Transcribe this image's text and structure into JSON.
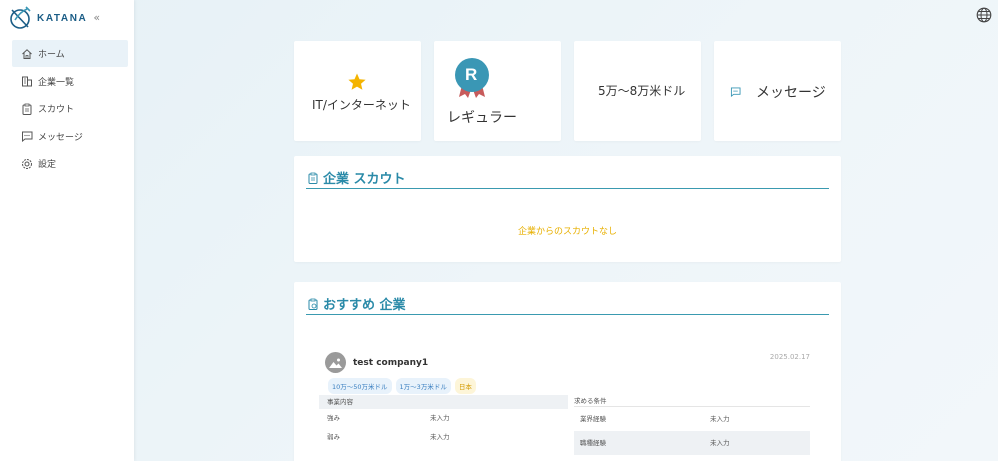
{
  "app": {
    "name": "KATANA",
    "collapse_icon": "«"
  },
  "sidebar": {
    "items": [
      {
        "label": "ホーム",
        "icon": "home-icon",
        "active": true
      },
      {
        "label": "企業一覧",
        "icon": "building-icon"
      },
      {
        "label": "スカウト",
        "icon": "clipboard-icon"
      },
      {
        "label": "メッセージ",
        "icon": "chat-icon"
      },
      {
        "label": "設定",
        "icon": "gear-icon"
      }
    ]
  },
  "stats": {
    "industry": "IT/インターネット",
    "rank_letter": "R",
    "rank_label": "レギュラー",
    "salary": "5万～8万米ドル",
    "messages": "メッセージ"
  },
  "scout": {
    "title": "企業 スカウト",
    "empty": "企業からのスカウトなし"
  },
  "recommended": {
    "title": "おすすめ 企業",
    "company": {
      "name": "test company1",
      "date": "2025.02.17",
      "tags": [
        "10万～50万米ドル",
        "1万～3万米ドル",
        "日本"
      ],
      "business_header": "事業内容",
      "business_rows": [
        {
          "key": "強み",
          "value": "未入力"
        },
        {
          "key": "弱み",
          "value": "未入力"
        }
      ],
      "req_header": "求める条件",
      "req_rows": [
        {
          "key": "業界経験",
          "value": "未入力"
        },
        {
          "key": "職種経験",
          "value": "未入力"
        }
      ]
    }
  },
  "colors": {
    "accent": "#2a8aa8",
    "star": "#f4b400",
    "badge": "#3a97b5",
    "warning": "#e8b000"
  }
}
